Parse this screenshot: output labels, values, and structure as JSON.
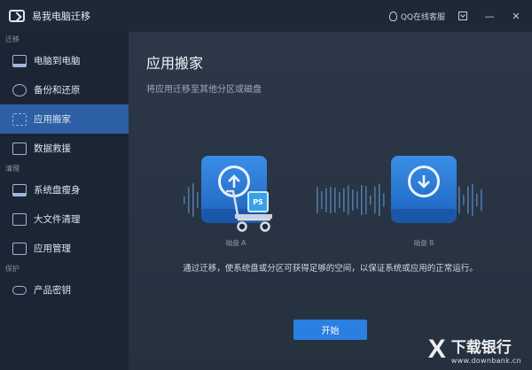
{
  "app": {
    "title": "易我电脑迁移"
  },
  "titlebar": {
    "qq_label": "QQ在线客服"
  },
  "sidebar": {
    "sections": [
      {
        "label": "迁移",
        "items": [
          {
            "label": "电脑到电脑",
            "icon": "monitor-icon"
          },
          {
            "label": "备份和还原",
            "icon": "backup-icon"
          },
          {
            "label": "应用搬家",
            "icon": "app-move-icon",
            "active": true
          },
          {
            "label": "数据救援",
            "icon": "rescue-icon"
          }
        ]
      },
      {
        "label": "清理",
        "items": [
          {
            "label": "系统盘瘦身",
            "icon": "broom-icon"
          },
          {
            "label": "大文件清理",
            "icon": "folder-icon"
          },
          {
            "label": "应用管理",
            "icon": "trash-icon"
          }
        ]
      },
      {
        "label": "保护",
        "items": [
          {
            "label": "产品密钥",
            "icon": "key-icon"
          }
        ]
      }
    ]
  },
  "main": {
    "title": "应用搬家",
    "subtitle": "将应用迁移至其他分区或磁盘",
    "disk_a_label": "磁盘 A",
    "disk_b_label": "磁盘 B",
    "app_badge": "PS",
    "description": "通过迁移，使系统盘或分区可获得足够的空间，以保证系统或应用的正常运行。",
    "start_button": "开始"
  },
  "watermark": {
    "mark": "X",
    "name": "下载银行",
    "url": "www.downbank.cn"
  },
  "colors": {
    "accent": "#2a7fe0",
    "active_nav": "#2c5fa3",
    "disk_blue": "#2f7fdc"
  }
}
